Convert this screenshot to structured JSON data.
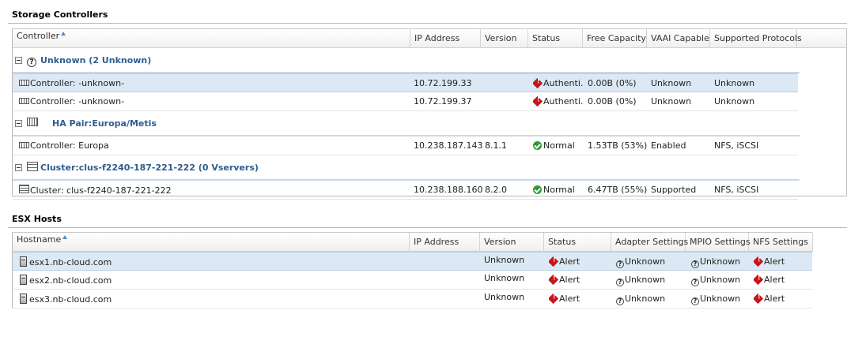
{
  "storage": {
    "title": "Storage Controllers",
    "columns": [
      "Controller",
      "IP Address",
      "Version",
      "Status",
      "Free Capacity",
      "VAAI Capable",
      "Supported Protocols"
    ],
    "groups": [
      {
        "title": "Unknown (2 Unknown)",
        "icon": "question-icon",
        "rows": [
          {
            "name": "Controller: -unknown-",
            "ip": "10.72.199.33",
            "version": "",
            "status": "Authenti...",
            "status_type": "error",
            "free": "0.00B (0%)",
            "vaai": "Unknown",
            "protocols": "Unknown",
            "selected": true
          },
          {
            "name": "Controller: -unknown-",
            "ip": "10.72.199.37",
            "version": "",
            "status": "Authenti...",
            "status_type": "error",
            "free": "0.00B (0%)",
            "vaai": "Unknown",
            "protocols": "Unknown",
            "selected": false
          }
        ]
      },
      {
        "title": "HA Pair:Europa/Metis",
        "icon": "ha-pair-icon",
        "rows": [
          {
            "name": "Controller: Europa",
            "ip": "10.238.187.143",
            "version": "8.1.1",
            "status": "Normal",
            "status_type": "ok",
            "free": "1.53TB (53%)",
            "vaai": "Enabled",
            "protocols": "NFS, iSCSI",
            "selected": false
          }
        ]
      },
      {
        "title": "Cluster:clus-f2240-187-221-222 (0 Vservers)",
        "icon": "cluster-icon",
        "rows": [
          {
            "name": "Cluster: clus-f2240-187-221-222",
            "ip": "10.238.188.160",
            "version": "8.2.0",
            "status": "Normal",
            "status_type": "ok",
            "free": "6.47TB (55%)",
            "vaai": "Supported",
            "protocols": "NFS, iSCSI",
            "selected": false
          }
        ]
      }
    ]
  },
  "esx": {
    "title": "ESX Hosts",
    "columns": [
      "Hostname",
      "IP Address",
      "Version",
      "Status",
      "Adapter Settings",
      "MPIO Settings",
      "NFS Settings"
    ],
    "rows": [
      {
        "hostname": "esx1.nb-cloud.com",
        "ip": "",
        "version": "Unknown",
        "status": "Alert",
        "adapter": "Unknown",
        "mpio": "Unknown",
        "nfs": "Alert",
        "selected": true
      },
      {
        "hostname": "esx2.nb-cloud.com",
        "ip": "",
        "version": "Unknown",
        "status": "Alert",
        "adapter": "Unknown",
        "mpio": "Unknown",
        "nfs": "Alert",
        "selected": false
      },
      {
        "hostname": "esx3.nb-cloud.com",
        "ip": "",
        "version": "Unknown",
        "status": "Alert",
        "adapter": "Unknown",
        "mpio": "Unknown",
        "nfs": "Alert",
        "selected": false
      }
    ]
  }
}
